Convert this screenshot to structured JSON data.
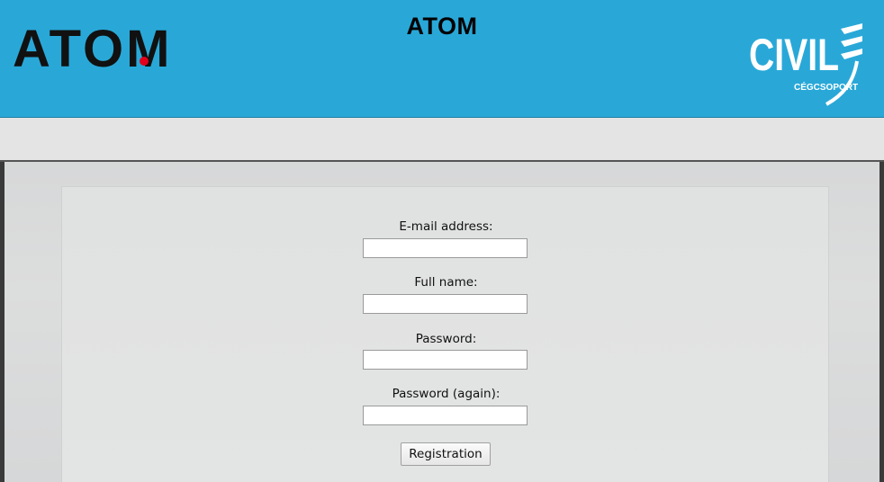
{
  "header": {
    "title": "ATOM",
    "logo_left_text": "ATOM",
    "logo_right_text": "CIVIL",
    "logo_right_subtext": "CÉGCSOPORT",
    "background_color": "#29a8d8",
    "logo_dot_color": "#e3001b"
  },
  "form": {
    "fields": [
      {
        "label": "E-mail address:",
        "value": "",
        "type": "email"
      },
      {
        "label": "Full name:",
        "value": "",
        "type": "text"
      },
      {
        "label": "Password:",
        "value": "",
        "type": "password"
      },
      {
        "label": "Password (again):",
        "value": "",
        "type": "password"
      }
    ],
    "submit_label": "Registration"
  },
  "icons": {
    "logo_left": "atom-logo-icon",
    "logo_right": "civil-logo-icon"
  }
}
